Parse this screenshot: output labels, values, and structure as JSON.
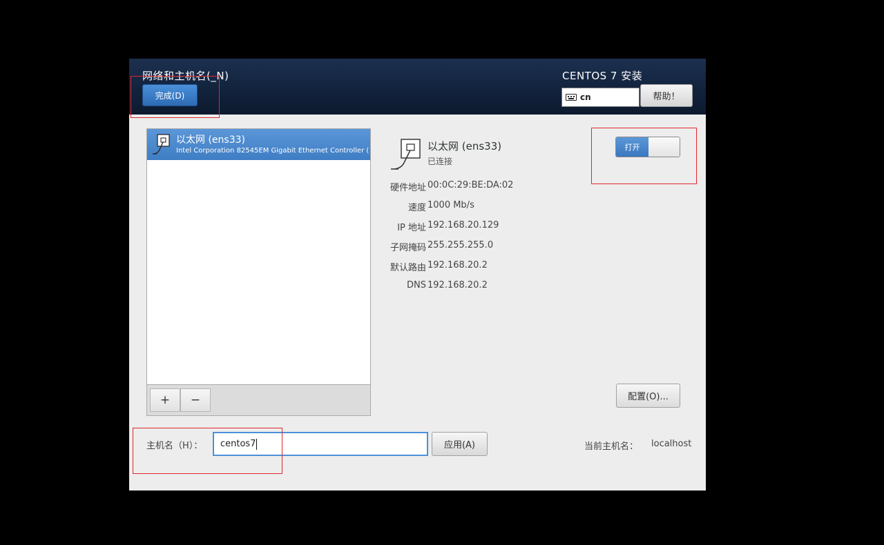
{
  "header": {
    "title": "网络和主机名(_N)",
    "done_label": "完成(D)",
    "install_title": "CENTOS 7 安装",
    "keyboard_layout": "cn",
    "help_label": "帮助！"
  },
  "device_list": {
    "items": [
      {
        "name": "以太网 (ens33)",
        "description": "Intel Corporation 82545EM Gigabit Ethernet Controller ("
      }
    ],
    "add_label": "+",
    "remove_label": "−"
  },
  "details": {
    "name": "以太网 (ens33)",
    "status": "已连接",
    "toggle_label": "打开",
    "rows": [
      {
        "label": "硬件地址",
        "value": "00:0C:29:BE:DA:02"
      },
      {
        "label": "速度",
        "value": "1000 Mb/s"
      },
      {
        "label": "IP 地址",
        "value": "192.168.20.129"
      },
      {
        "label": "子网掩码",
        "value": "255.255.255.0"
      },
      {
        "label": "默认路由",
        "value": "192.168.20.2"
      },
      {
        "label": "DNS",
        "value": "192.168.20.2"
      }
    ],
    "configure_label": "配置(O)..."
  },
  "hostname": {
    "label": "主机名（H）：",
    "value": "centos7",
    "apply_label": "应用(A)",
    "current_label": "当前主机名：",
    "current_value": "localhost"
  },
  "colors": {
    "header_bg": "#12233d",
    "accent": "#3f7dc4",
    "highlight": "#e0262b"
  }
}
